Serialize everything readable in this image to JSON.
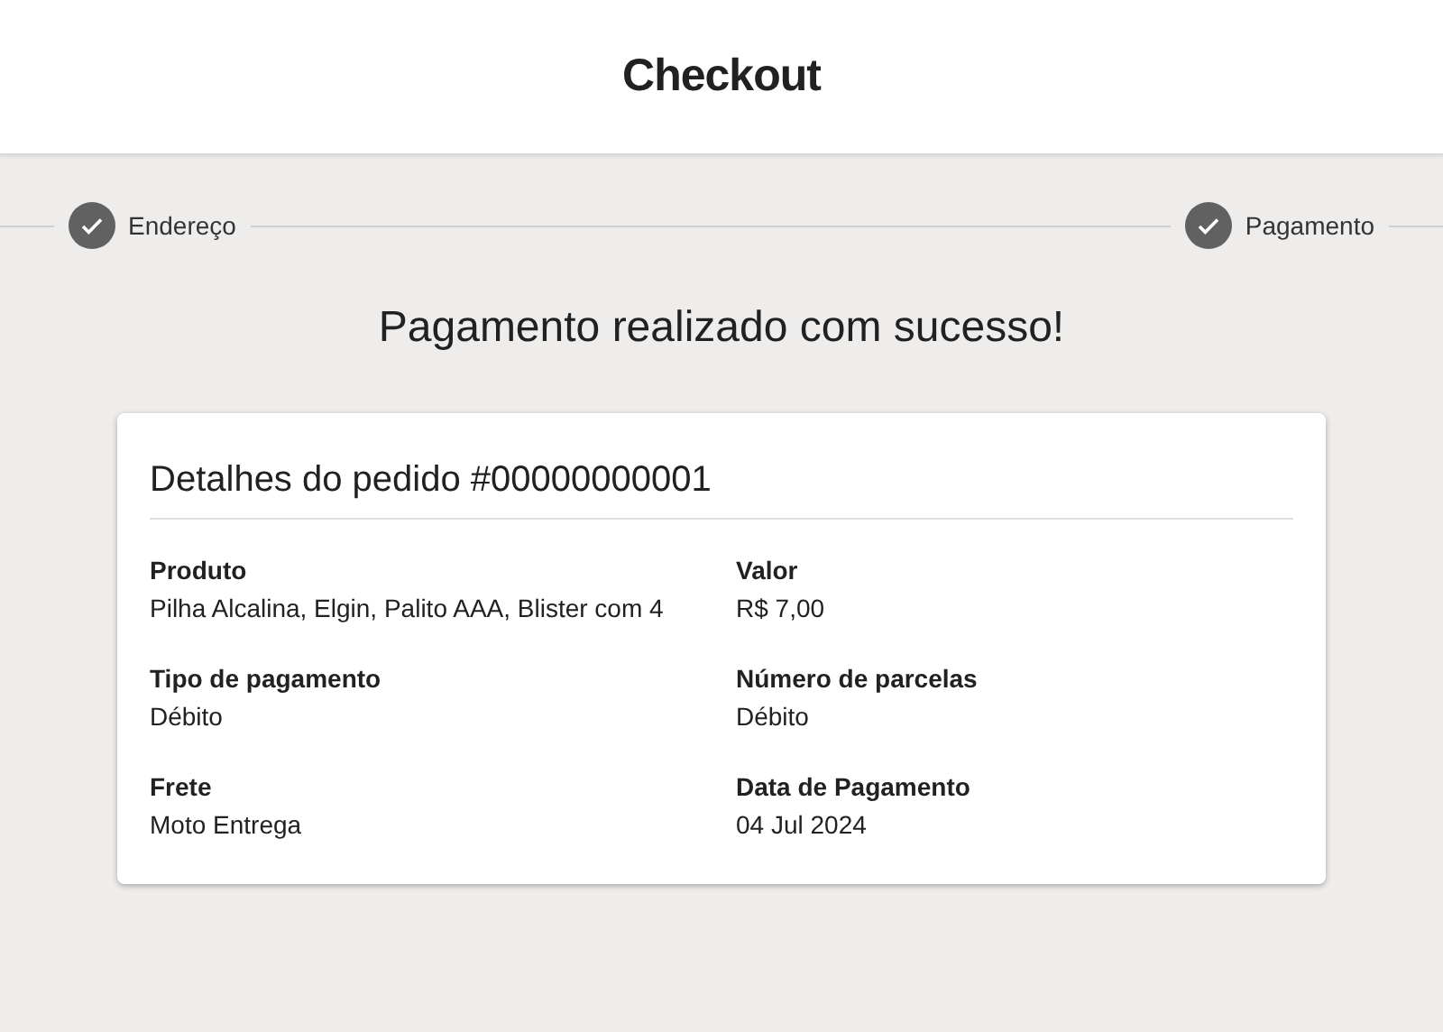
{
  "header": {
    "title": "Checkout"
  },
  "steps": [
    {
      "label": "Endereço",
      "completed": true
    },
    {
      "label": "Pagamento",
      "completed": true
    }
  ],
  "message": "Pagamento realizado com sucesso!",
  "order": {
    "title": "Detalhes do pedido #00000000001",
    "fields": [
      {
        "label": "Produto",
        "value": "Pilha Alcalina, Elgin, Palito AAA, Blister com 4"
      },
      {
        "label": "Valor",
        "value": "R$ 7,00"
      },
      {
        "label": "Tipo de pagamento",
        "value": "Débito"
      },
      {
        "label": "Número de parcelas",
        "value": "Débito"
      },
      {
        "label": "Frete",
        "value": "Moto Entrega"
      },
      {
        "label": "Data de Pagamento",
        "value": "04 Jul 2024"
      }
    ]
  }
}
